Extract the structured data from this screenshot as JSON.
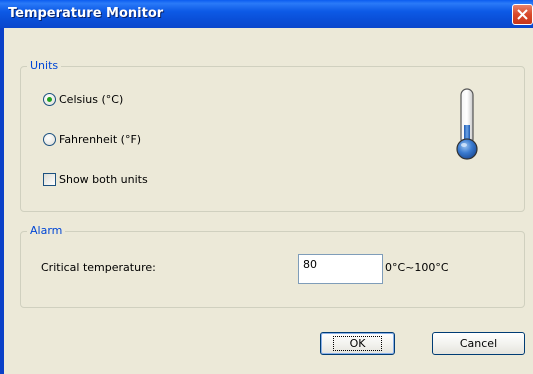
{
  "window": {
    "title": "Temperature Monitor"
  },
  "units": {
    "group_label": "Units",
    "celsius_label": "Celsius (°C)",
    "fahrenheit_label": "Fahrenheit (°F)",
    "show_both_label": "Show both units",
    "selected": "celsius",
    "show_both_checked": false
  },
  "alarm": {
    "group_label": "Alarm",
    "critical_label": "Critical temperature:",
    "critical_value": "80",
    "range_label": "0°C~100°C"
  },
  "buttons": {
    "ok_label": "OK",
    "cancel_label": "Cancel"
  },
  "icons": {
    "close": "close-icon",
    "thermometer": "thermometer-icon"
  },
  "colors": {
    "titlebar": "#0a4fd8",
    "close_button": "#d9492a",
    "group_label": "#0046d5",
    "radio_dot": "#21a121",
    "thermometer_liquid": "#2f6fc0"
  }
}
